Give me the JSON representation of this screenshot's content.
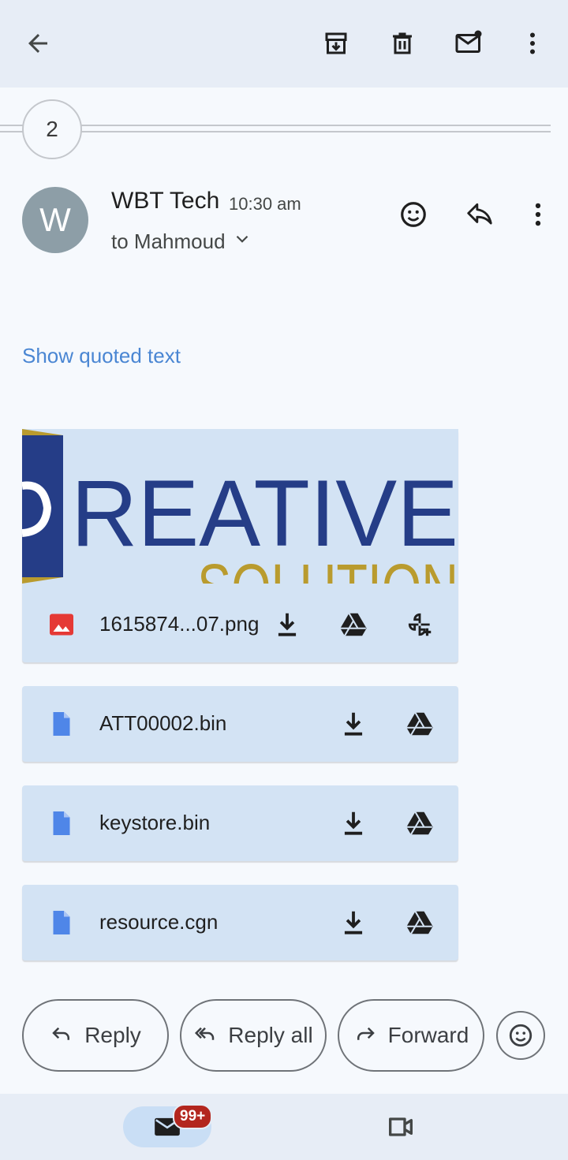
{
  "toolbar": {
    "icons": [
      "back-arrow-icon",
      "archive-icon",
      "delete-icon",
      "mark-unread-icon",
      "more-vert-icon"
    ]
  },
  "thread": {
    "count": "2"
  },
  "message": {
    "avatar_letter": "W",
    "sender": "WBT Tech",
    "time": "10:30 am",
    "recipient": "to Mahmoud",
    "show_quoted": "Show quoted text"
  },
  "preview_image": {
    "line1": "REATIVE",
    "line2": "SOLUTION",
    "colors": {
      "navy": "#253d87",
      "gold": "#b99b2e",
      "background": "#d3e3f4"
    }
  },
  "attachments": [
    {
      "name": "1615874...07.png",
      "type": "image",
      "actions": [
        "download-icon",
        "drive-icon",
        "add-to-photos-icon"
      ]
    },
    {
      "name": "ATT00002.bin",
      "type": "file",
      "actions": [
        "download-icon",
        "drive-icon"
      ]
    },
    {
      "name": "keystore.bin",
      "type": "file",
      "actions": [
        "download-icon",
        "drive-icon"
      ]
    },
    {
      "name": "resource.cgn",
      "type": "file",
      "actions": [
        "download-icon",
        "drive-icon"
      ]
    }
  ],
  "actions": {
    "reply": "Reply",
    "reply_all": "Reply all",
    "forward": "Forward"
  },
  "bottom_nav": {
    "mail_badge": "99+"
  },
  "colors": {
    "app_bar": "#e7edf6",
    "background": "#f6f9fd",
    "attachment_bg": "#d3e3f4",
    "link": "#4a86d3",
    "image_icon_red": "#e53935",
    "file_icon_blue": "#4f86e8",
    "badge": "#b3261e"
  }
}
